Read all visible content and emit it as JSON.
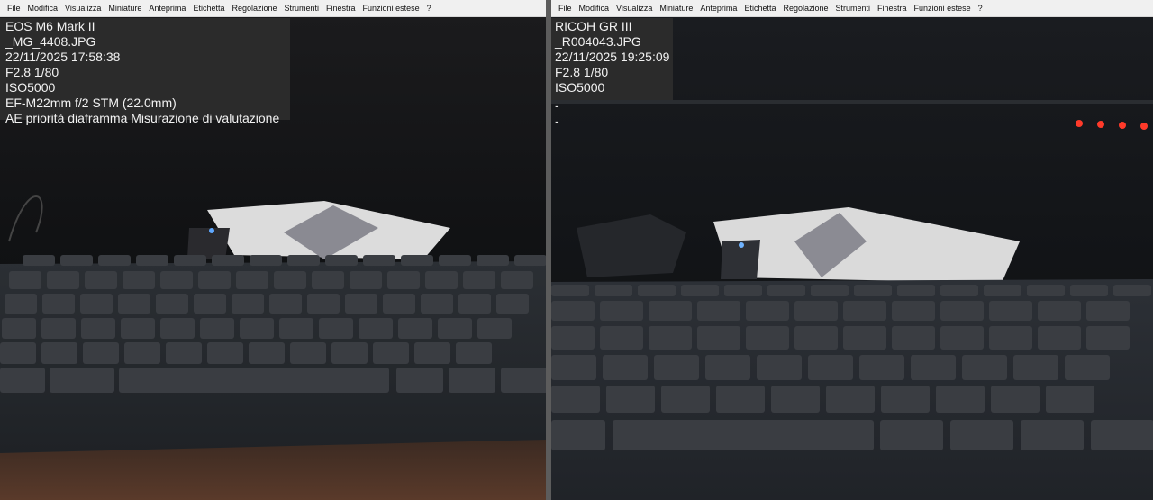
{
  "menu": [
    "File",
    "Modifica",
    "Visualizza",
    "Miniature",
    "Anteprima",
    "Etichetta",
    "Regolazione",
    "Strumenti",
    "Finestra",
    "Funzioni estese",
    "?"
  ],
  "left": {
    "info": [
      "EOS M6 Mark II",
      "_MG_4408.JPG",
      "22/11/2025 17:58:38",
      "F2.8 1/80",
      "ISO5000",
      "EF-M22mm f/2 STM (22.0mm)",
      "AE priorità diaframma Misurazione di valutazione"
    ]
  },
  "right": {
    "info": [
      "RICOH GR III",
      "_R004043.JPG",
      "22/11/2025 19:25:09",
      "F2.8 1/80",
      "ISO5000"
    ],
    "extra": [
      "-",
      "-"
    ]
  },
  "colors": {
    "menubar": "#f0f0f0",
    "info_box": "#2b2b2b",
    "key": "#3a3d42",
    "keyboard_body": "#25282c"
  }
}
